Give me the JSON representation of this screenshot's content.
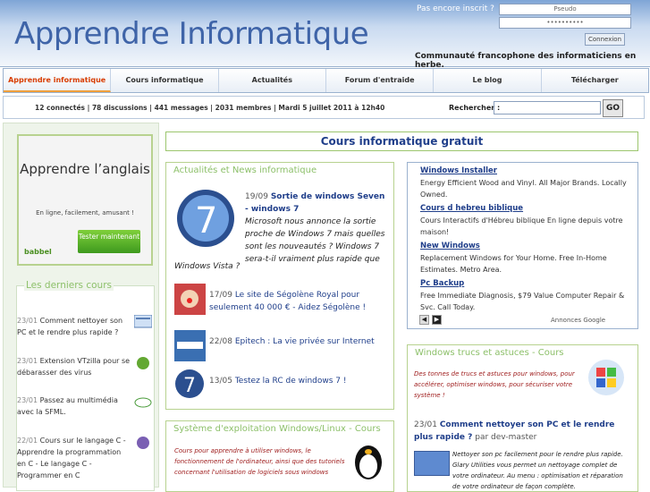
{
  "header": {
    "logo": "Apprendre Informatique",
    "login_question": "Pas encore inscrit ?",
    "pseudo_placeholder": "Pseudo",
    "password_placeholder": "••••••••••",
    "connect_label": "Connexion",
    "tagline": "Communauté francophone des informaticiens en herbe."
  },
  "nav": {
    "items": [
      "Apprendre informatique",
      "Cours informatique",
      "Actualités",
      "Forum d'entraide",
      "Le blog",
      "Télécharger"
    ]
  },
  "statusbar": {
    "stats": "12 connectés | 78 discussions | 441 messages | 2031 membres | Mardi 5 juillet 2011 à 12h40",
    "search_label": "Rechercher :",
    "go_label": "GO"
  },
  "ad_babbel": {
    "title": "Apprendre l’anglais",
    "subtitle": "En ligne, facilement, amusant !",
    "button": "Tester maintenant",
    "brand": "babbel"
  },
  "recent_courses": {
    "title": "Les derniers cours",
    "items": [
      {
        "date": "23/01",
        "text": "Comment nettoyer son PC et le rendre plus rapide ?"
      },
      {
        "date": "23/01",
        "text": "Extension VTzilla pour se débarasser des virus"
      },
      {
        "date": "23/01",
        "text": "Passez au multimédia avec la SFML."
      },
      {
        "date": "22/01",
        "text": "Cours sur le langage C - Apprendre la programmation en C - Le langage C - Programmer en C"
      }
    ]
  },
  "main_title": "Cours informatique gratuit",
  "news": {
    "title": "Actualités et News informatique",
    "headline_date": "19/09",
    "headline_link": "Sortie de windows Seven - windows 7",
    "headline_desc": "Microsoft nous annonce la sortie proche de Windows 7 mais quelles sont les nouveautés ? Windows 7 sera-t-il vraiment plus rapide que",
    "headline_desc2": "Windows Vista ?",
    "items": [
      {
        "date": "17/09",
        "text": "Le site de Ségolène Royal pour seulement 40 000 € - Aidez Ségolène !"
      },
      {
        "date": "22/08",
        "text": "Epitech : La vie privée sur Internet"
      },
      {
        "date": "13/05",
        "text": "Testez la RC de windows 7 !"
      }
    ]
  },
  "systems": {
    "title": "Système d'exploitation Windows/Linux - Cours",
    "desc": "Cours pour apprendre à utiliser windows, le fonctionnement de l'ordinateur, ainsi que des tutoriels concernant l'utilisation de logiciels sous windows"
  },
  "google_ads": {
    "ads": [
      {
        "title": "Windows Installer",
        "body": "Energy Efficient Wood and Vinyl. All Major Brands. Locally Owned."
      },
      {
        "title": "Cours d hebreu biblique",
        "body": "Cours Interactifs d'Hébreu biblique En ligne depuis votre maison!"
      },
      {
        "title": "New Windows",
        "body": "Replacement Windows for Your Home. Free In-Home Estimates. Metro Area."
      },
      {
        "title": "Pc Backup",
        "body": "Free Immediate Diagnosis, $79 Value Computer Repair & Svc. Call Today."
      }
    ],
    "label": "Annonces Google"
  },
  "tips": {
    "title": "Windows trucs et astuces - Cours",
    "desc": "Des tonnes de trucs et astuces pour windows, pour accélérer, optimiser windows, pour sécuriser votre système !",
    "item_date": "23/01",
    "item_link": "Comment nettoyer son PC et le rendre plus rapide ?",
    "item_author": "par dev-master",
    "detail": "Nettoyer son pc facilement pour le rendre plus rapide. Glary Utilities vous permet un nettoyage complet de votre ordinateur. Au menu : optimisation et réparation de votre ordinateur de façon complète."
  }
}
